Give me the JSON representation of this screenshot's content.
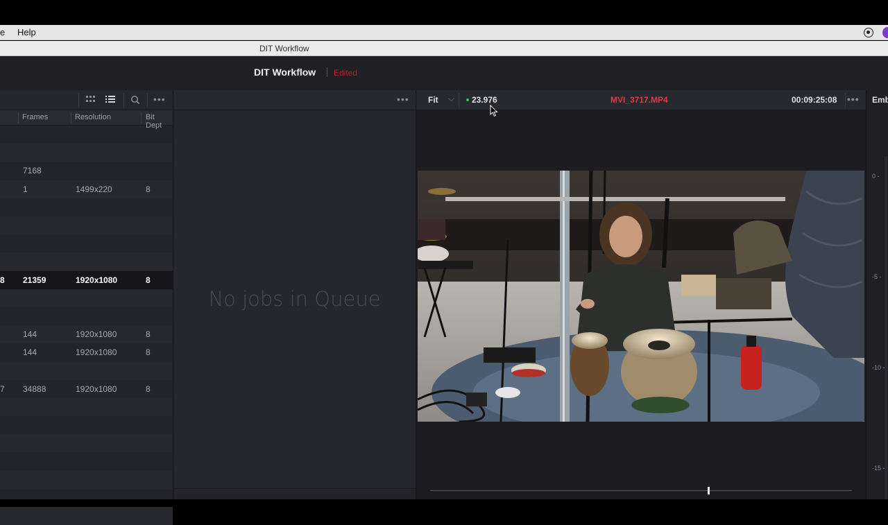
{
  "menubar": {
    "items": [
      "e",
      "Help"
    ]
  },
  "window": {
    "title": "DIT Workflow"
  },
  "header": {
    "project_name": "DIT Workflow",
    "status": "Edited"
  },
  "media_pool": {
    "columns": [
      "Frames",
      "Resolution",
      "Bit Dept"
    ],
    "rows": [
      {
        "lead": "",
        "frames": "",
        "resolution": "",
        "bit_depth": ""
      },
      {
        "lead": "",
        "frames": "",
        "resolution": "",
        "bit_depth": ""
      },
      {
        "lead": "",
        "frames": "7168",
        "resolution": "",
        "bit_depth": ""
      },
      {
        "lead": "",
        "frames": "1",
        "resolution": "1499x220",
        "bit_depth": "8"
      },
      {
        "lead": "",
        "frames": "",
        "resolution": "",
        "bit_depth": ""
      },
      {
        "lead": "",
        "frames": "",
        "resolution": "",
        "bit_depth": ""
      },
      {
        "lead": "",
        "frames": "",
        "resolution": "",
        "bit_depth": ""
      },
      {
        "lead": "",
        "frames": "",
        "resolution": "",
        "bit_depth": ""
      },
      {
        "lead": "8",
        "frames": "21359",
        "resolution": "1920x1080",
        "bit_depth": "8",
        "selected": true
      },
      {
        "lead": "",
        "frames": "",
        "resolution": "",
        "bit_depth": ""
      },
      {
        "lead": "",
        "frames": "",
        "resolution": "",
        "bit_depth": ""
      },
      {
        "lead": "",
        "frames": "144",
        "resolution": "1920x1080",
        "bit_depth": "8"
      },
      {
        "lead": "",
        "frames": "144",
        "resolution": "1920x1080",
        "bit_depth": "8"
      },
      {
        "lead": "",
        "frames": "",
        "resolution": "",
        "bit_depth": ""
      },
      {
        "lead": "7",
        "frames": "34888",
        "resolution": "1920x1080",
        "bit_depth": "8"
      },
      {
        "lead": "",
        "frames": "",
        "resolution": "",
        "bit_depth": ""
      },
      {
        "lead": "",
        "frames": "",
        "resolution": "",
        "bit_depth": ""
      },
      {
        "lead": "",
        "frames": "",
        "resolution": "",
        "bit_depth": ""
      },
      {
        "lead": "",
        "frames": "",
        "resolution": "",
        "bit_depth": ""
      },
      {
        "lead": "",
        "frames": "",
        "resolution": "",
        "bit_depth": ""
      },
      {
        "lead": "",
        "frames": "",
        "resolution": "",
        "bit_depth": ""
      },
      {
        "lead": "",
        "frames": "",
        "resolution": "",
        "bit_depth": ""
      }
    ],
    "icons": [
      "grid-view-icon",
      "list-view-icon",
      "search-icon",
      "more-options-icon"
    ]
  },
  "render_queue": {
    "empty_message": "No jobs in Queue"
  },
  "viewer": {
    "zoom": "Fit",
    "fps": "23.976",
    "clip_name": "MVI_3717.MP4",
    "timecode": "00:09:25:08",
    "playhead_fraction": 0.66
  },
  "meters": {
    "tab_label": "Emb",
    "ticks": [
      "0 -",
      "-5 -",
      "-10 -",
      "-15 -"
    ]
  },
  "colors": {
    "clip_name": "#e0394a",
    "edited": "#b1222a",
    "fps_indicator": "#3fbf5f"
  }
}
